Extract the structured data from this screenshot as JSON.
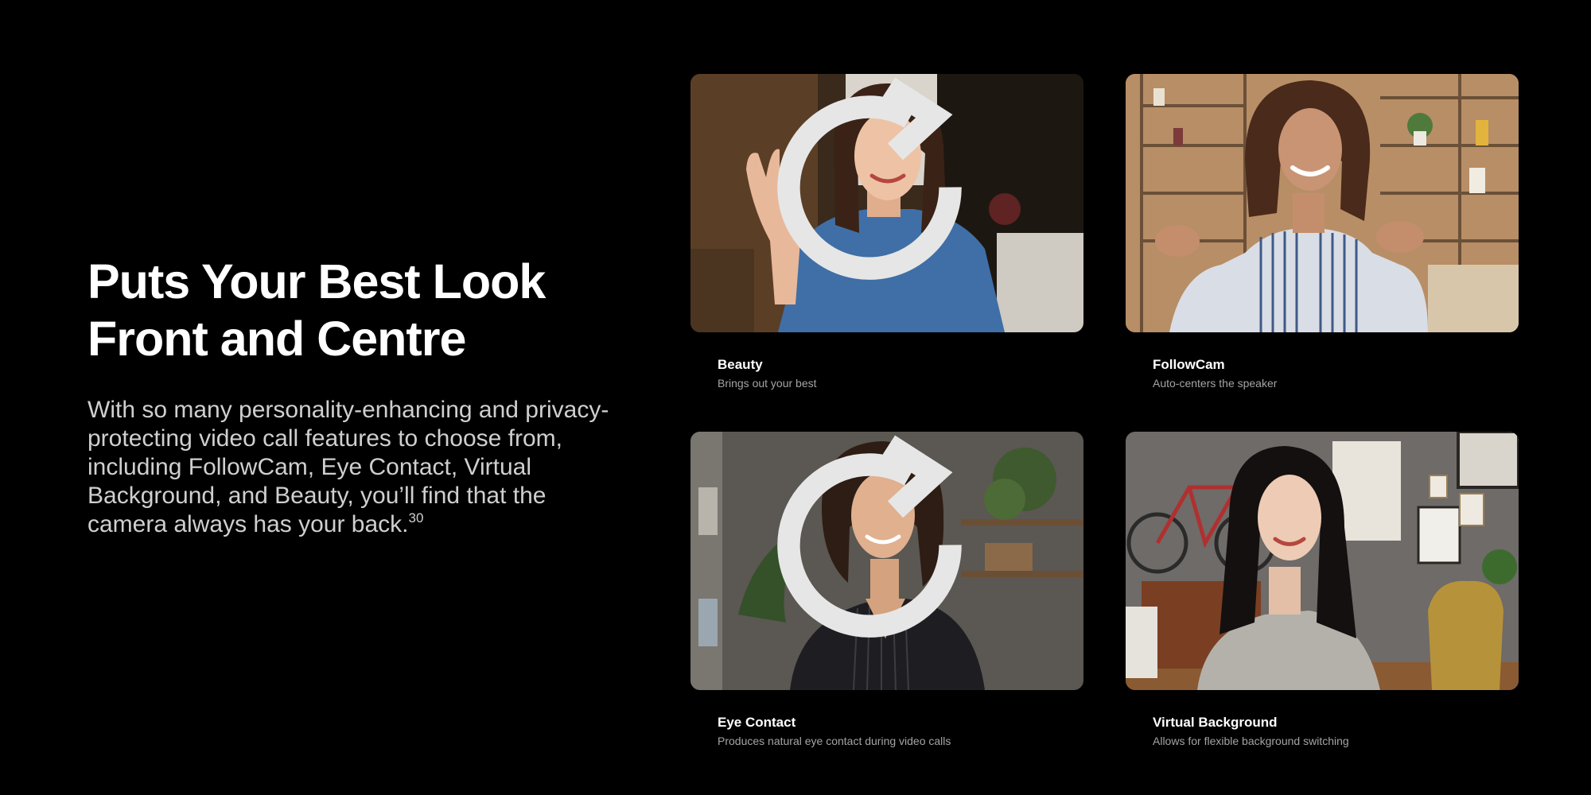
{
  "intro": {
    "headline_line1": "Puts Your Best Look",
    "headline_line2": "Front and Centre",
    "body": "With so many personality-enhancing and privacy-protecting video call features to choose from, including FollowCam, Eye Contact, Virtual Background, and Beauty, you’ll find that the camera always has your back.",
    "footnote": "30"
  },
  "cards": [
    {
      "title": "Beauty",
      "subtitle": "Brings out your best",
      "icon": "replay-icon"
    },
    {
      "title": "FollowCam",
      "subtitle": "Auto-centers the speaker"
    },
    {
      "title": "Eye Contact",
      "subtitle": "Produces natural eye contact during video calls",
      "icon": "replay-icon"
    },
    {
      "title": "Virtual Background",
      "subtitle": "Allows for flexible background switching"
    }
  ],
  "colors": {
    "background": "#000000",
    "headline": "#ffffff",
    "body_text": "#cfcfcf",
    "caption_subtitle": "#a4a4a4"
  }
}
